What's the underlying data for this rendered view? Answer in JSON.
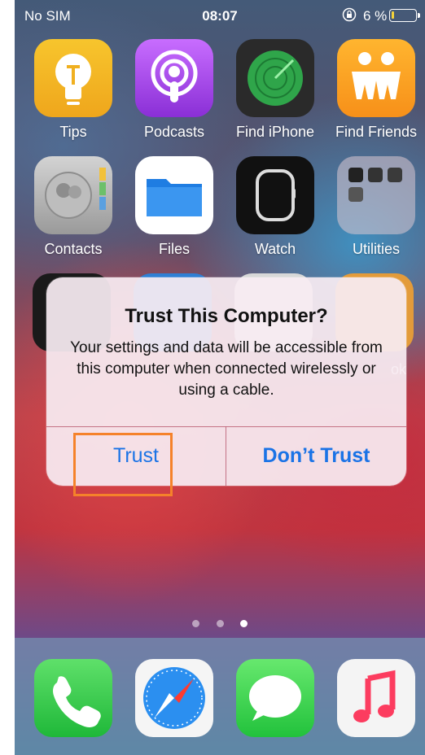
{
  "status_bar": {
    "carrier": "No SIM",
    "time": "08:07",
    "battery_pct": "6 %",
    "battery_level": 0.06
  },
  "apps": {
    "row1": [
      {
        "label": "Tips",
        "icon": "tips-icon"
      },
      {
        "label": "Podcasts",
        "icon": "podcasts-icon"
      },
      {
        "label": "Find iPhone",
        "icon": "find-iphone-icon"
      },
      {
        "label": "Find Friends",
        "icon": "find-friends-icon"
      }
    ],
    "row2": [
      {
        "label": "Contacts",
        "icon": "contacts-icon"
      },
      {
        "label": "Files",
        "icon": "files-icon"
      },
      {
        "label": "Watch",
        "icon": "watch-icon"
      },
      {
        "label": "Utilities",
        "icon": "utilities-folder-icon"
      }
    ],
    "row3_partial_label": "ok"
  },
  "page_dots": {
    "count": 3,
    "active": 2
  },
  "dock": [
    {
      "icon": "phone-icon"
    },
    {
      "icon": "safari-icon"
    },
    {
      "icon": "messages-icon"
    },
    {
      "icon": "music-icon"
    }
  ],
  "alert": {
    "title": "Trust This Computer?",
    "message": "Your settings and data will be accessible from this computer when connected wirelessly or using a cable.",
    "buttons": {
      "trust": "Trust",
      "dont_trust": "Don’t Trust"
    },
    "button_color": "#1a73e6"
  },
  "highlight_color": "#f5822a"
}
